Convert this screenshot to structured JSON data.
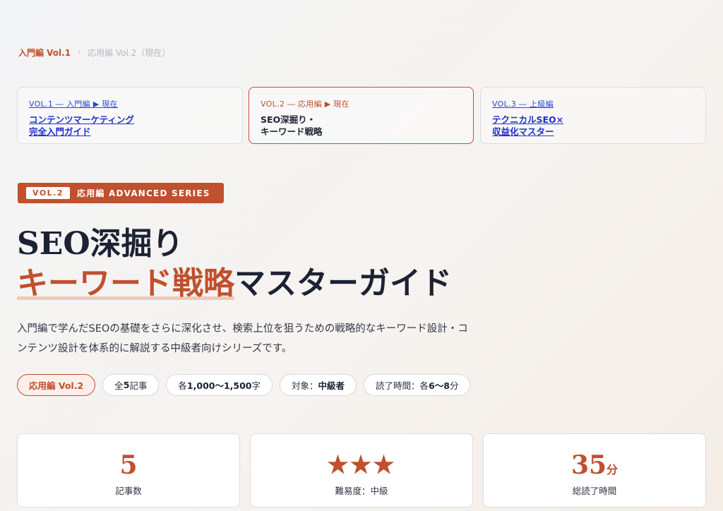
{
  "breadcrumb": {
    "current": "入門編 Vol.1",
    "separator": "›",
    "next": "応用編 Vol.2（現在）"
  },
  "series_cards": [
    {
      "vol": "VOL.1 ― 入門編 ▶ 現在",
      "title": "コンテンツマーケティング\n完全入門ガイド"
    },
    {
      "vol": "VOL.2 ― 応用編 ▶ 現在",
      "title": "SEO深掘り・\nキーワード戦略"
    },
    {
      "vol": "VOL.3 ― 上級編",
      "title": "テクニカルSEO×\n収益化マスター"
    }
  ],
  "badge": {
    "vol": "VOL.2",
    "label": "応用編 ADVANCED SERIES"
  },
  "title": {
    "line1": "SEO深掘り",
    "accent": "キーワード戦略",
    "rest": "マスターガイド"
  },
  "lead": "入門編で学んだSEOの基礎をさらに深化させ、検索上位を狙うための戦略的なキーワード設計・コンテンツ設計を体系的に解説する中級者向けシリーズです。",
  "tags": [
    {
      "text": "応用編 Vol.2",
      "active": true
    },
    {
      "prefix": "全",
      "bold": "5",
      "suffix": "記事"
    },
    {
      "prefix": "各 ",
      "bold": "1,000〜1,500",
      "suffix": "字"
    },
    {
      "prefix": "対象：",
      "bold": "中級者",
      "suffix": ""
    },
    {
      "prefix": "読了時間：各 ",
      "bold": "6〜8",
      "suffix": "分"
    }
  ],
  "stats": {
    "articles": {
      "value": "5",
      "label": "記事数"
    },
    "difficulty": {
      "stars": "★★★",
      "rating": 3,
      "label": "難易度：中級"
    },
    "time": {
      "value": "35",
      "unit": "分",
      "label": "総読了時間"
    }
  },
  "colors": {
    "accent": "#c0502e",
    "link": "#2a45d6",
    "text": "#1c2233"
  }
}
